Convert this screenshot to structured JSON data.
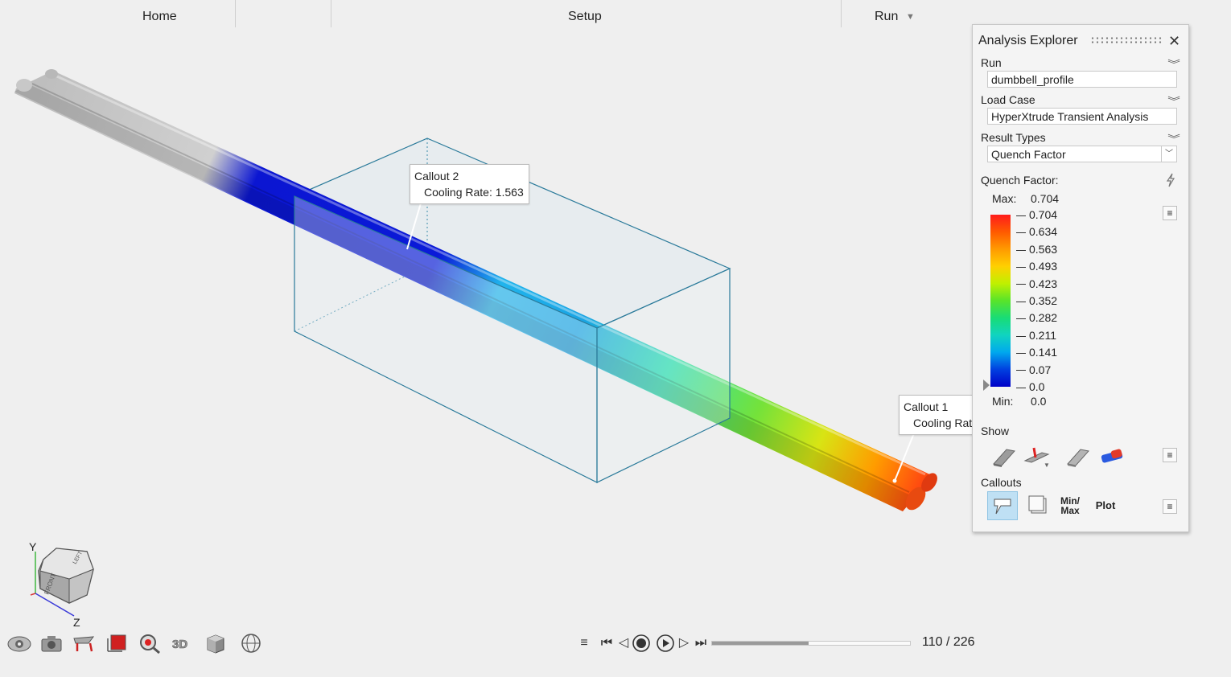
{
  "menu": {
    "home": "Home",
    "setup": "Setup",
    "run": "Run"
  },
  "callouts": [
    {
      "title": "Callout 2",
      "text": "Cooling Rate: 1.563"
    },
    {
      "title": "Callout 1",
      "text": "Cooling Rat"
    }
  ],
  "explorer": {
    "title": "Analysis Explorer",
    "run_label": "Run",
    "run_value": "dumbbell_profile",
    "loadcase_label": "Load Case",
    "loadcase_value": "HyperXtrude Transient Analysis",
    "result_types_label": "Result Types",
    "result_type_value": "Quench Factor",
    "legend_title": "Quench Factor:",
    "max_label": "Max:",
    "max_value": "0.704",
    "min_label": "Min:",
    "min_value": "0.0",
    "legend_values": [
      "0.704",
      "0.634",
      "0.563",
      "0.493",
      "0.423",
      "0.352",
      "0.282",
      "0.211",
      "0.141",
      "0.07",
      "0.0"
    ],
    "legend_colors": [
      "#ff1c1c",
      "#ff5a00",
      "#ff9a00",
      "#ffd000",
      "#c0f000",
      "#58e42a",
      "#18dc76",
      "#10d4c0",
      "#00a8ee",
      "#0040e0",
      "#0000c8"
    ],
    "show_label": "Show",
    "callouts_label": "Callouts",
    "minmax_label": "Min/\nMax",
    "plot_label": "Plot"
  },
  "view_cube": {
    "y_axis": "Y",
    "z_axis": "Z"
  },
  "playback": {
    "frame_current": 110,
    "frame_total": 226,
    "counter_text": "110 / 226"
  }
}
